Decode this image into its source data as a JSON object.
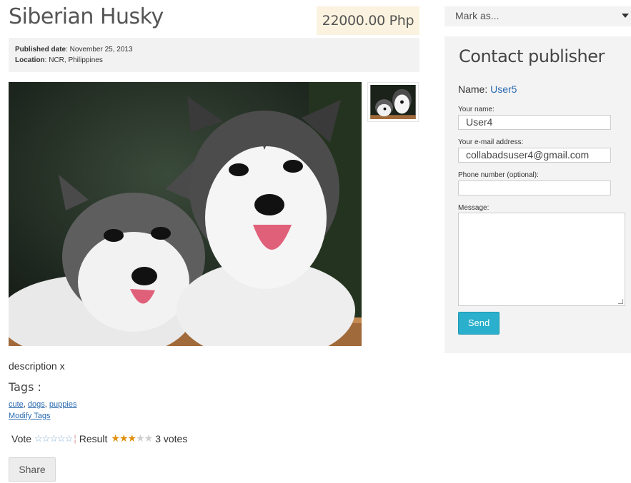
{
  "listing": {
    "title": "Siberian Husky",
    "price": "22000.00 Php",
    "published_label": "Published date",
    "published_value": ": November 25, 2013",
    "location_label": "Location",
    "location_value": ": NCR, Philippines",
    "main_image_icon": "husky-puppies-photo",
    "thumbnail_icon": "husky-puppies-thumbnail",
    "description": "description x"
  },
  "tags": {
    "heading": "Tags :",
    "items": [
      "cute",
      "dogs",
      "puppies"
    ],
    "separator": ", ",
    "modify_label": "Modify Tags"
  },
  "rating": {
    "vote_label": "Vote",
    "vote_stars": "☆☆☆☆☆",
    "separator": "¦",
    "result_label": "Result",
    "result_score": 3,
    "result_max": 5,
    "votes_text": "3 votes"
  },
  "share_label": "Share",
  "sidebar": {
    "mark_as": "Mark as...",
    "contact_title": "Contact publisher",
    "name_label": "Name:",
    "name_value": "User5",
    "your_name_label": "Your name:",
    "your_name_value": "User4",
    "email_label": "Your e-mail address:",
    "email_value": "collabadsuser4@gmail.com",
    "phone_label": "Phone number (optional):",
    "phone_value": "",
    "message_label": "Message:",
    "message_value": "",
    "send_label": "Send"
  },
  "colors": {
    "price_bg": "#fbf3df",
    "send_bg": "#2ab0cc",
    "link": "#2a6ab0",
    "star_on": "#e0900e"
  }
}
